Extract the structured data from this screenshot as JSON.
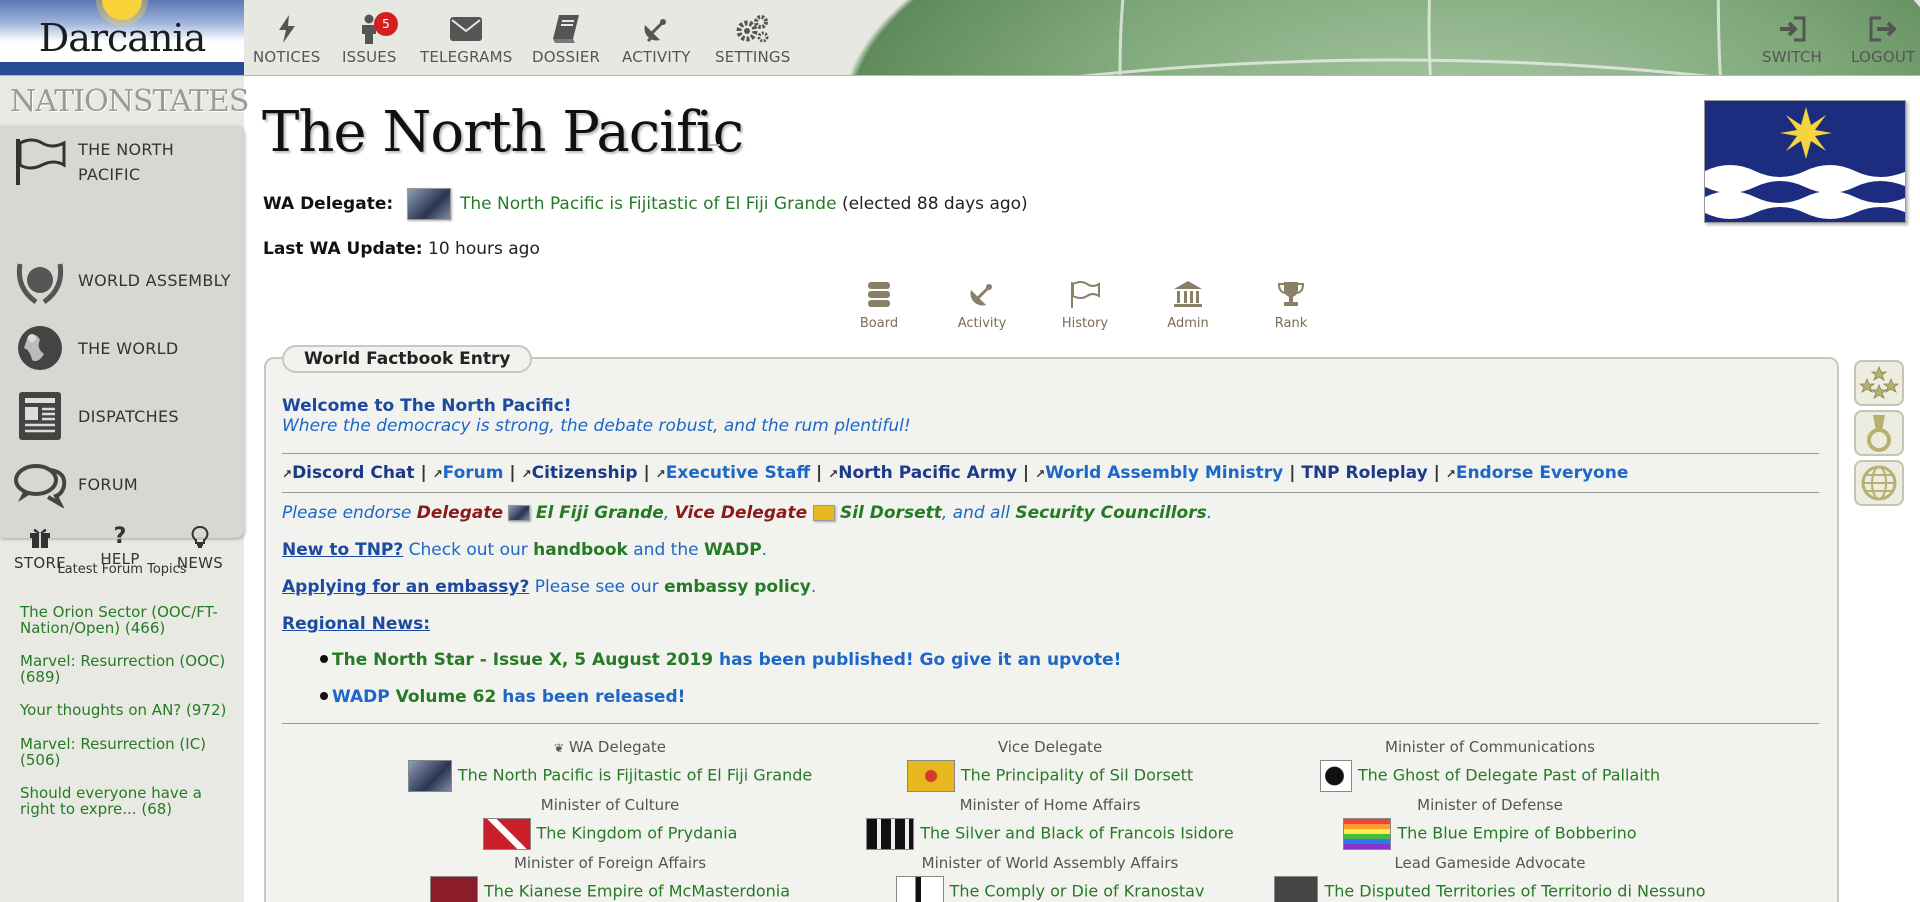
{
  "topbar": {
    "nation_name": "Darcania",
    "nav": [
      {
        "label": "NOTICES",
        "icon": "lightning-icon"
      },
      {
        "label": "ISSUES",
        "icon": "person-icon",
        "badge": "5"
      },
      {
        "label": "TELEGRAMS",
        "icon": "envelope-icon"
      },
      {
        "label": "DOSSIER",
        "icon": "book-icon"
      },
      {
        "label": "ACTIVITY",
        "icon": "satellite-icon"
      },
      {
        "label": "SETTINGS",
        "icon": "gears-icon"
      }
    ],
    "switch_label": "SWITCH",
    "logout_label": "LOGOUT"
  },
  "sidebar": {
    "site_title": "NATIONSTATES",
    "items": [
      {
        "label": "THE NORTH PACIFIC",
        "icon": "flag-icon"
      },
      {
        "label": "WORLD ASSEMBLY",
        "icon": "wa-emblem-icon"
      },
      {
        "label": "THE WORLD",
        "icon": "globe-icon"
      },
      {
        "label": "DISPATCHES",
        "icon": "newspaper-icon"
      },
      {
        "label": "FORUM",
        "icon": "speech-bubbles-icon"
      }
    ],
    "mini_items": [
      {
        "label": "STORE",
        "icon": "gift-icon"
      },
      {
        "label": "HELP",
        "icon": "question-icon"
      },
      {
        "label": "NEWS",
        "icon": "lightbulb-icon"
      }
    ],
    "forum_heading": "Latest Forum Topics",
    "forum_topics": [
      "The Orion Sector (OOC/FT-Nation/Open) (466)",
      "Marvel: Resurrection (OOC) (689)",
      "Your thoughts on AN? (972)",
      "Marvel: Resurrection (IC) (506)",
      "Should everyone have a right to expre... (68)"
    ]
  },
  "region": {
    "title": "The North Pacific",
    "wa_delegate_label": "WA Delegate:",
    "wa_delegate_name": "The North Pacific is Fijitastic of El Fiji Grande",
    "wa_delegate_note": "(elected 88 days ago)",
    "last_update_label": "Last WA Update:",
    "last_update_value": "10 hours ago",
    "tabs": [
      {
        "label": "Board",
        "icon": "board-icon"
      },
      {
        "label": "Activity",
        "icon": "satellite-icon"
      },
      {
        "label": "History",
        "icon": "flag-icon"
      },
      {
        "label": "Admin",
        "icon": "bank-icon"
      },
      {
        "label": "Rank",
        "icon": "trophy-icon"
      }
    ]
  },
  "factbook": {
    "tab_label": "World Factbook Entry",
    "welcome": "Welcome to The North Pacific!",
    "tagline": "Where the democracy is strong, the debate robust, and the rum plentiful!",
    "links": [
      "Discord Chat",
      "Forum",
      "Citizenship",
      "Executive Staff",
      "North Pacific Army",
      "World Assembly Ministry",
      "TNP Roleplay",
      "Endorse Everyone"
    ],
    "sep": "|",
    "endorse": {
      "pre": "Please endorse ",
      "delegate_label": "Delegate",
      "delegate_name": "El Fiji Grande",
      "comma1": ", ",
      "vice_label": "Vice Delegate",
      "vice_name": "Sil Dorsett",
      "mid": ", and all ",
      "councillors": "Security Councillors",
      "end": "."
    },
    "new_line": {
      "lead": "New to TNP?",
      "t1": " Check out our ",
      "handbook": "handbook",
      "t2": " and the ",
      "wadp": "WADP",
      "end": "."
    },
    "embassy_line": {
      "lead": "Applying for an embassy?",
      "t1": " Please see our ",
      "policy": "embassy policy",
      "end": "."
    },
    "news_heading": "Regional News:",
    "news": [
      {
        "bold": "The North Star - Issue X, 5 August 2019",
        "rest": " has been published! Go give it an upvote!"
      },
      {
        "bold": "WADP",
        "mid": " Volume 62",
        "rest": " has been released!"
      }
    ]
  },
  "officers": [
    {
      "title": "WA Delegate",
      "name": "The North Pacific is Fijitastic of El Fiji Grande"
    },
    {
      "title": "Vice Delegate",
      "name": "The Principality of Sil Dorsett"
    },
    {
      "title": "Minister of Communications",
      "name": "The Ghost of Delegate Past of Pallaith"
    },
    {
      "title": "Minister of Culture",
      "name": "The Kingdom of Prydania"
    },
    {
      "title": "Minister of Home Affairs",
      "name": "The Silver and Black of Francois Isidore"
    },
    {
      "title": "Minister of Defense",
      "name": "The Blue Empire of Bobberino"
    },
    {
      "title": "Minister of Foreign Affairs",
      "name": "The Kianese Empire of McMasterdonia"
    },
    {
      "title": "Minister of World Assembly Affairs",
      "name": "The Comply or Die of Kranostav"
    },
    {
      "title": "Lead Gameside Advocate",
      "name": "The Disputed Territories of Territorio di Nessuno"
    }
  ],
  "colors": {
    "link_green": "#257b25",
    "link_blue": "#1c67c8",
    "badge_red": "#d42020",
    "flag_blue": "#1c2d7f"
  }
}
